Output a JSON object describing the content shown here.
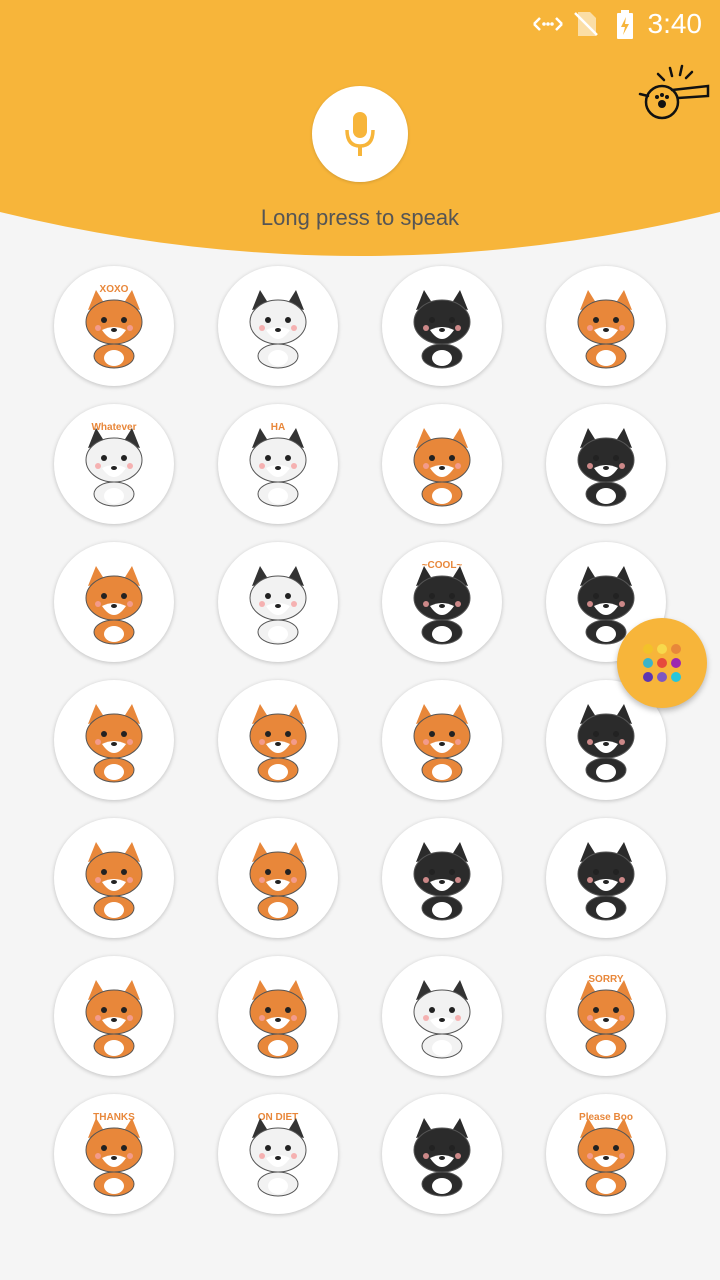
{
  "status_bar": {
    "time": "3:40"
  },
  "voice": {
    "hint": "Long press to speak"
  },
  "colors": {
    "header": "#F7B53A",
    "background": "#f5f5f5",
    "fab": "#F7B53A",
    "sticker_orange": "#E8873A",
    "sticker_dark": "#2b2b2b"
  },
  "stickers": [
    {
      "name": "corgi-xoxo-sticker",
      "label": "XOXO",
      "kind": "corgi"
    },
    {
      "name": "white-dog-hearts-sticker",
      "label": "",
      "kind": "white"
    },
    {
      "name": "husky-zzz-sticker",
      "label": "",
      "kind": "husky"
    },
    {
      "name": "corgi-blanket-sticker",
      "label": "",
      "kind": "corgi"
    },
    {
      "name": "white-dog-whatever-sticker",
      "label": "Whatever",
      "kind": "white"
    },
    {
      "name": "white-dog-haha-sticker",
      "label": "HA",
      "kind": "white"
    },
    {
      "name": "corgi-laugh-sticker",
      "label": "",
      "kind": "corgi"
    },
    {
      "name": "husky-hmph-sticker",
      "label": "",
      "kind": "husky"
    },
    {
      "name": "corgi-macarons-sticker",
      "label": "",
      "kind": "corgi"
    },
    {
      "name": "dogs-group-sticker",
      "label": "",
      "kind": "white"
    },
    {
      "name": "husky-cool-sticker",
      "label": "~COOL~",
      "kind": "husky"
    },
    {
      "name": "husky-sad-sticker",
      "label": "",
      "kind": "husky"
    },
    {
      "name": "corgi-cheer-sticker",
      "label": "",
      "kind": "corgi"
    },
    {
      "name": "corgi-shark-sticker",
      "label": "",
      "kind": "corgi"
    },
    {
      "name": "corgi-shock-sticker",
      "label": "",
      "kind": "corgi"
    },
    {
      "name": "husky-dark-sticker",
      "label": "",
      "kind": "husky"
    },
    {
      "name": "corgi-lamp-sticker",
      "label": "",
      "kind": "corgi"
    },
    {
      "name": "corgi-cow-sticker",
      "label": "",
      "kind": "corgi"
    },
    {
      "name": "husky-front-sticker",
      "label": "",
      "kind": "husky"
    },
    {
      "name": "husky-messy-sticker",
      "label": "",
      "kind": "husky"
    },
    {
      "name": "corgi-shout-sticker",
      "label": "",
      "kind": "corgi"
    },
    {
      "name": "corgi-chat-sticker",
      "label": "",
      "kind": "corgi"
    },
    {
      "name": "white-dog-sweat-sticker",
      "label": "",
      "kind": "white"
    },
    {
      "name": "corgi-sorry-sticker",
      "label": "SORRY",
      "kind": "corgi"
    },
    {
      "name": "corgi-thanks-sticker",
      "label": "THANKS",
      "kind": "corgi"
    },
    {
      "name": "white-dog-diet-sticker",
      "label": "ON DIET",
      "kind": "white"
    },
    {
      "name": "husky-spiral-sticker",
      "label": "",
      "kind": "husky"
    },
    {
      "name": "corgi-please-sticker",
      "label": "Please Boo",
      "kind": "corgi"
    }
  ],
  "fab": {
    "dots": [
      "#F3C12A",
      "#F7D94C",
      "#E8873A",
      "#3BB4C9",
      "#E64A3C",
      "#9C27B0",
      "#5E35B1",
      "#7E57C2",
      "#26C6DA"
    ]
  }
}
